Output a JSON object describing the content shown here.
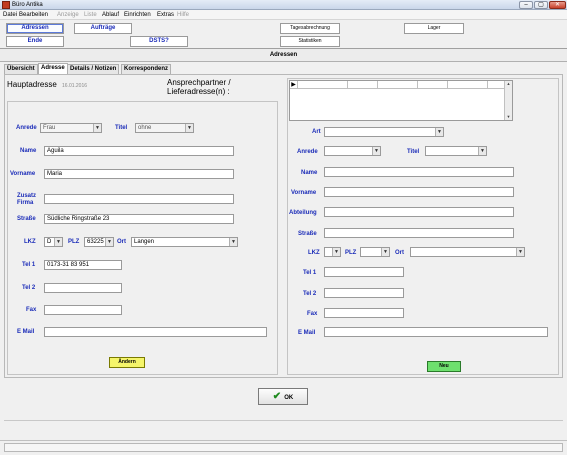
{
  "window": {
    "title": "Büro Antika",
    "controls": {
      "minimize": "–",
      "maximize": "▢",
      "close": "✕"
    }
  },
  "menu": {
    "items": [
      {
        "label": "Datei",
        "enabled": true
      },
      {
        "label": "Bearbeiten",
        "enabled": true
      },
      {
        "label": "Anzeige",
        "enabled": false
      },
      {
        "label": "Liste",
        "enabled": false
      },
      {
        "label": "Ablauf",
        "enabled": true
      },
      {
        "label": "Einrichten",
        "enabled": true
      },
      {
        "label": "Extras",
        "enabled": true
      },
      {
        "label": "Hilfe",
        "enabled": false
      }
    ]
  },
  "toolbar": {
    "adressen": "Adressen",
    "auftraege": "Aufträge",
    "ende": "Ende",
    "dsts": "DSTS?",
    "tagesabrechnung": "Tagesabrechnung",
    "statistiken": "Statistiken",
    "lager": "Lager"
  },
  "header": {
    "title": "Adressen"
  },
  "tabs": [
    {
      "label": "Übersicht",
      "active": false
    },
    {
      "label": "Adresse",
      "active": true
    },
    {
      "label": "Details / Notizen",
      "active": false
    },
    {
      "label": "Korrespondenz",
      "active": false
    }
  ],
  "left": {
    "title": "Hauptadresse",
    "date": "16.01.2016",
    "labels": {
      "anrede": "Anrede",
      "titel": "Titel",
      "name": "Name",
      "vorname": "Vorname",
      "zusatz_firma_1": "Zusatz",
      "zusatz_firma_2": "Firma",
      "strasse": "Straße",
      "lkz": "LKZ",
      "plz": "PLZ",
      "ort": "Ort",
      "tel1": "Tel 1",
      "tel2": "Tel 2",
      "fax": "Fax",
      "email": "E Mail"
    },
    "values": {
      "anrede": "Frau",
      "titel": "ohne",
      "name": "Aguila",
      "vorname": "Maria",
      "zusatz_firma": "",
      "strasse": "Südliche Ringstraße 23",
      "lkz": "D",
      "plz": "63225",
      "ort": "Langen",
      "tel1": "0173-31 83 951",
      "tel2": "",
      "fax": "",
      "email": ""
    },
    "button": "Ändern"
  },
  "right": {
    "title_line1": "Ansprechpartner /",
    "title_line2": "Lieferadresse(n) :",
    "grid_marker": "▶",
    "labels": {
      "art": "Art",
      "anrede": "Anrede",
      "titel": "Titel",
      "name": "Name",
      "vorname": "Vorname",
      "abteilung": "Abteilung",
      "strasse": "Straße",
      "lkz": "LKZ",
      "plz": "PLZ",
      "ort": "Ort",
      "tel1": "Tel 1",
      "tel2": "Tel 2",
      "fax": "Fax",
      "email": "E Mail"
    },
    "button": "Neu"
  },
  "footer": {
    "ok": "OK",
    "ok_icon": "✔"
  },
  "icons": {
    "dropdown": "▼",
    "scroll_up": "▲",
    "scroll_down": "▼"
  },
  "colors": {
    "label_blue": "#1a2bb8",
    "yellow_button": "#f5f56a",
    "green_button": "#6ee06e",
    "ok_check_green": "#1e8a1e"
  }
}
